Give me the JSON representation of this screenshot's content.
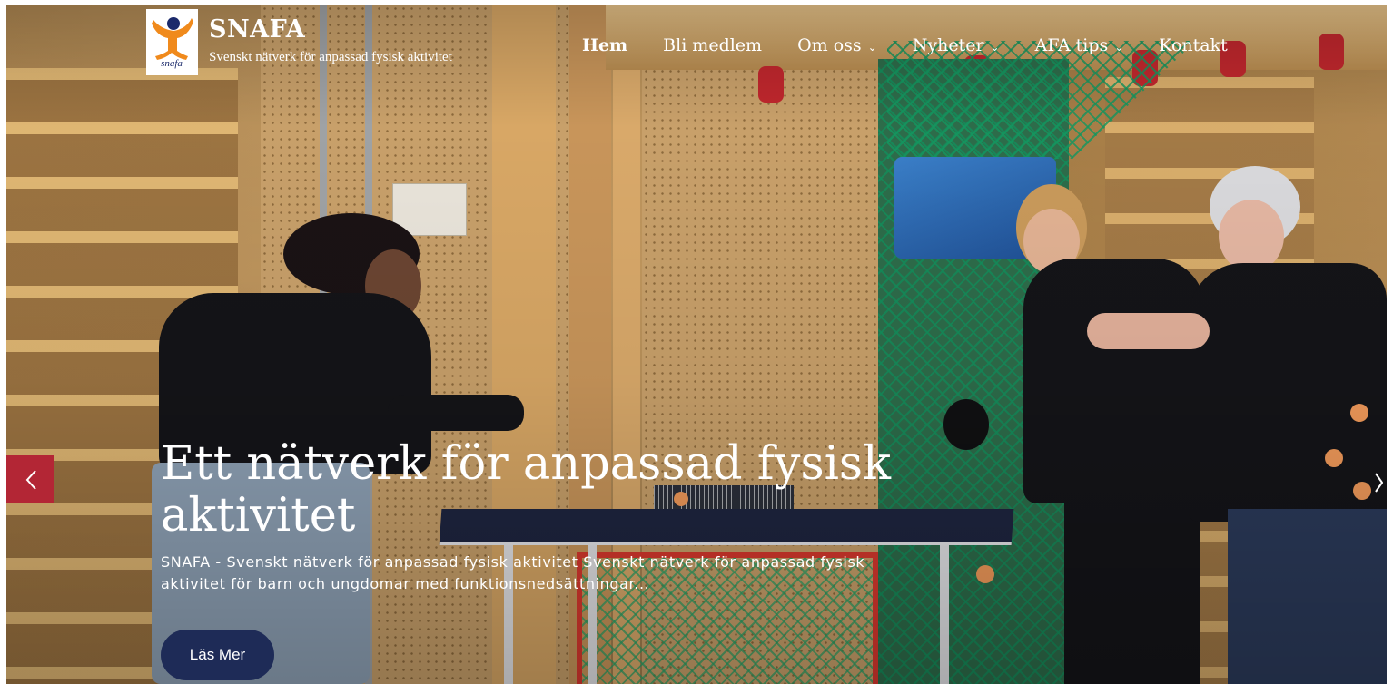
{
  "site": {
    "name": "SNAFA",
    "tagline": "Svenskt nätverk för anpassad fysisk aktivitet"
  },
  "nav": {
    "items": [
      {
        "label": "Hem",
        "active": true,
        "dropdown": false
      },
      {
        "label": "Bli medlem",
        "active": false,
        "dropdown": false
      },
      {
        "label": "Om oss",
        "active": false,
        "dropdown": true
      },
      {
        "label": "Nyheter",
        "active": false,
        "dropdown": true
      },
      {
        "label": "AFA tips",
        "active": false,
        "dropdown": true
      },
      {
        "label": "Kontakt",
        "active": false,
        "dropdown": false
      }
    ]
  },
  "hero": {
    "title": "Ett nätverk för anpassad fysisk aktivitet",
    "description": "SNAFA - Svenskt nätverk för anpassad fysisk aktivitet Svenskt nätverk för anpassad fysisk aktivitet för barn och ungdomar med funktionsnedsättningar...",
    "cta_label": "Läs Mer"
  },
  "icons": {
    "logo": "snafa-logo",
    "prev": "chevron-left-icon",
    "next": "chevron-right-icon",
    "dropdown": "chevron-down-icon"
  },
  "colors": {
    "slider_arrow": "#b32635",
    "cta_background": "#1e2b57",
    "logo_orange": "#f08a1c",
    "logo_navy": "#1b2a6b"
  }
}
